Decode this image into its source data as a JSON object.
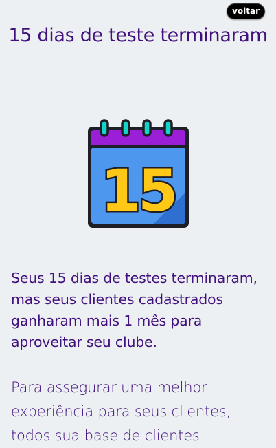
{
  "header": {
    "back_label": "voltar",
    "title": "15 dias de teste terminaram"
  },
  "illustration": {
    "icon": "calendar-15-icon",
    "number": "15",
    "colors": {
      "calendar_top": "#9b1fd6",
      "calendar_body": "#4d97ee",
      "number_fill": "#ffc816",
      "rings": "#16d3c8"
    }
  },
  "content": {
    "lead": "Seus 15 dias de testes terminaram, mas seus clientes cadastrados ganharam mais 1 mês para aproveitar seu clube.",
    "body": "Para assegurar uma melhor experiência para seus clientes, todos sua base de clientes"
  },
  "colors": {
    "background": "#edf0f2",
    "text": "#40107c",
    "button_bg": "#000000"
  }
}
